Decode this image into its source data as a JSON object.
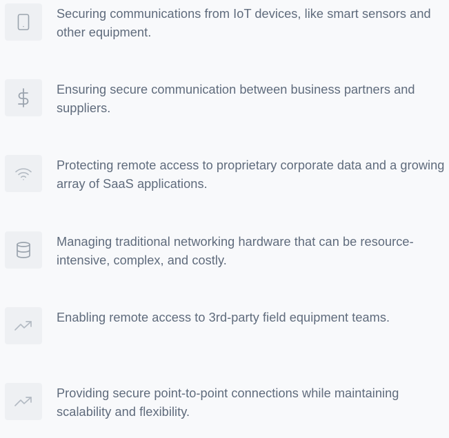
{
  "features": [
    {
      "icon": "tablet-icon",
      "text": "Securing communications from IoT devices, like smart sensors and other equipment."
    },
    {
      "icon": "dollar-icon",
      "text": "Ensuring secure communication between business partners and suppliers."
    },
    {
      "icon": "wifi-icon",
      "text": "Protecting remote access to proprietary corporate data and a growing array of SaaS applications."
    },
    {
      "icon": "database-icon",
      "text": "Managing traditional networking hardware that can be resource-intensive, complex, and costly."
    },
    {
      "icon": "trending-up-icon",
      "text": "Enabling remote access to 3rd-party field equipment teams."
    },
    {
      "icon": "trending-up-icon",
      "text": "Providing secure point-to-point connections while maintaining scalability and flexibility."
    }
  ],
  "colors": {
    "background": "#f8f9fb",
    "icon_tile": "#eef0f3",
    "icon_stroke": "#9aa3ad",
    "text": "#5f6b7c"
  }
}
